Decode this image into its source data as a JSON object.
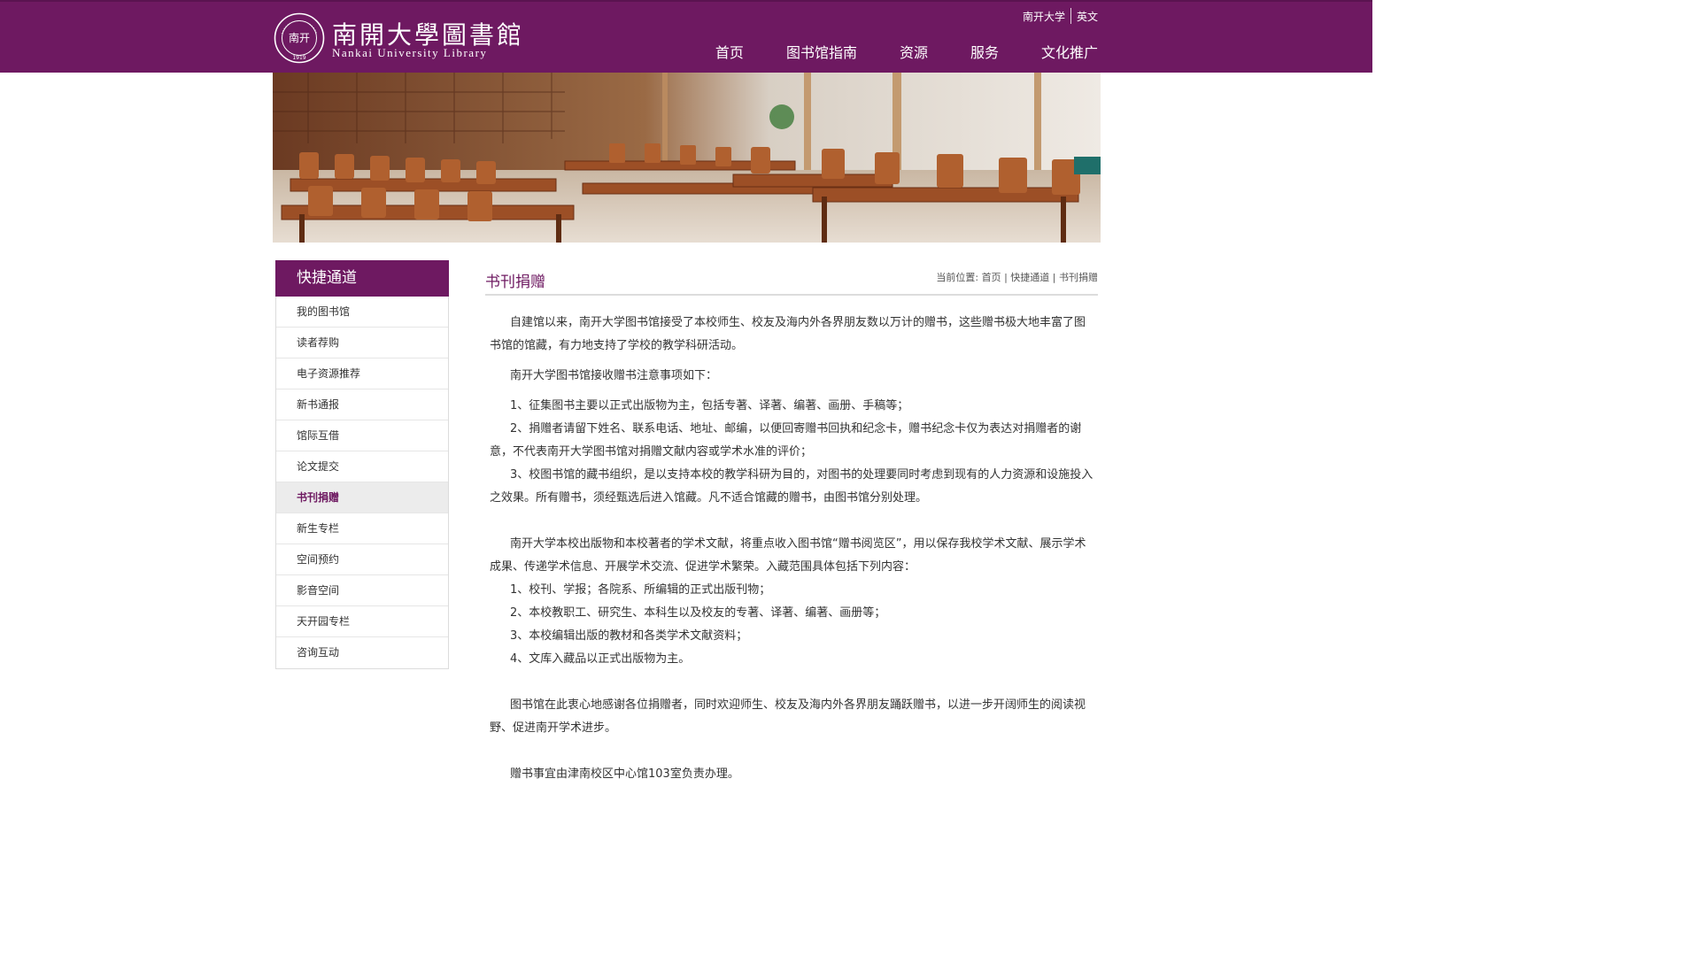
{
  "header": {
    "logo_cn": "南開大學圖書館",
    "logo_en": "Nankai University Library",
    "seal_text_top": "NANKAI UNIVERSITY",
    "seal_center": "南开",
    "seal_year": "1919",
    "top_links": [
      "南开大学",
      "英文"
    ],
    "nav": [
      "首页",
      "图书馆指南",
      "资源",
      "服务",
      "文化推广"
    ]
  },
  "sidebar": {
    "title": "快捷通道",
    "items": [
      "我的图书馆",
      "读者荐购",
      "电子资源推荐",
      "新书通报",
      "馆际互借",
      "论文提交",
      "书刊捐赠",
      "新生专栏",
      "空间预约",
      "影音空间",
      "天开园专栏",
      "咨询互动"
    ],
    "active_index": 6
  },
  "content": {
    "title": "书刊捐赠",
    "breadcrumb_label": "当前位置:",
    "breadcrumb": [
      "首页",
      "快捷通道",
      "书刊捐赠"
    ],
    "paragraphs": [
      "自建馆以来，南开大学图书馆接受了本校师生、校友及海内外各界朋友数以万计的赠书，这些赠书极大地丰富了图书馆的馆藏，有力地支持了学校的教学科研活动。",
      "南开大学图书馆接收赠书注意事项如下：",
      "1、征集图书主要以正式出版物为主，包括专著、译著、编著、画册、手稿等；",
      "2、捐赠者请留下姓名、联系电话、地址、邮编，以便回寄赠书回执和纪念卡，赠书纪念卡仅为表达对捐赠者的谢意，不代表南开大学图书馆对捐赠文献内容或学术水准的评价；",
      "3、校图书馆的藏书组织，是以支持本校的教学科研为目的，对图书的处理要同时考虑到现有的人力资源和设施投入之效果。所有赠书，须经甄选后进入馆藏。凡不适合馆藏的赠书，由图书馆分别处理。",
      "南开大学本校出版物和本校著者的学术文献，将重点收入图书馆“赠书阅览区”，用以保存我校学术文献、展示学术成果、传递学术信息、开展学术交流、促进学术繁荣。入藏范围具体包括下列内容：",
      "1、校刊、学报；各院系、所编辑的正式出版刊物；",
      "2、本校教职工、研究生、本科生以及校友的专著、译著、编著、画册等；",
      "3、本校编辑出版的教材和各类学术文献资料；",
      "4、文库入藏品以正式出版物为主。",
      "图书馆在此衷心地感谢各位捐赠者，同时欢迎师生、校友及海内外各界朋友踊跃赠书，以进一步开阔师生的阅读视野、促进南开学术进步。",
      "赠书事宜由津南校区中心馆103室负责办理。"
    ]
  },
  "colors": {
    "brand": "#6e1961",
    "sidebar_active_bg": "#ececec"
  }
}
